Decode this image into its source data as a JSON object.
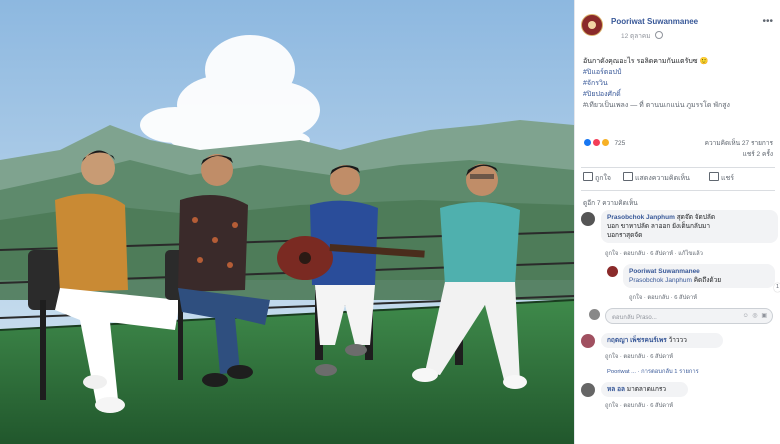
{
  "post": {
    "author": "Pooriwat Suwanmanee",
    "date": "12 ตุลาคม",
    "more_label": "•••",
    "caption_text": "อันกาดังคุณอะไร รอลิดคามกันแตรับซ 🙂",
    "hashtags": [
      "#ปิแอร์ตอปป์",
      "#จักรวิน",
      "#ปิยปองศักดิ์"
    ],
    "place_line": "#เทียวเป็นเพลง — ที่ ตานนเกแน่น ภูมรรโด พักสูง"
  },
  "stats": {
    "reaction_count": "725",
    "comments_label": "ความคิดเห็น 27 รายการ",
    "shares_label": "แชร์ 2 ครั้ง"
  },
  "actions": {
    "like": "ถูกใจ",
    "comment": "แสดงความคิดเห็น",
    "share": "แชร์"
  },
  "comments": {
    "previous_label": "ดูอีก 7 ความคิดเห็น",
    "items": [
      {
        "name": "Prasobchok Janphum",
        "text_line1": "สุดจ๊ด จัดปลัด",
        "text_line2": "บอก ขาหาปลัด ลาออก ยังเต็นกลับมา",
        "text_line3": "บอกราสุดจัด",
        "meta": "ถูกใจ · ตอบกลับ · 6 สัปดาห์ · แก้ไขแล้ว"
      }
    ],
    "reply": {
      "name": "Pooriwat Suwanmanee",
      "mention": "Prasobchok Janphum",
      "text": "คิดถึงด้วย",
      "meta": "ถูกใจ · ตอบกลับ · 6 สัปดาห์",
      "reaction_badge": "1"
    },
    "input_placeholder": "ตอบกลับ Praso...",
    "input_icons": "☺ ◎ ▣",
    "more_items": [
      {
        "name": "กฤตญา เพ็ชรคนร์เพร",
        "text": "ว้าววว",
        "meta": "ถูกใจ · ตอบกลับ · 6 สัปดาห์",
        "replies": "Pooriwat ... · การตอบกลับ 1 รายการ"
      },
      {
        "name": "หล อล",
        "text": "มาตลาดแกรว",
        "meta": "ถูกใจ · ตอบกลับ · 6 สัปดาห์"
      }
    ]
  },
  "colors": {
    "link_blue": "#385898",
    "bubble_bg": "#f2f3f5",
    "sky": "#bcd7ee",
    "stage_green": "#2e6b3a"
  }
}
